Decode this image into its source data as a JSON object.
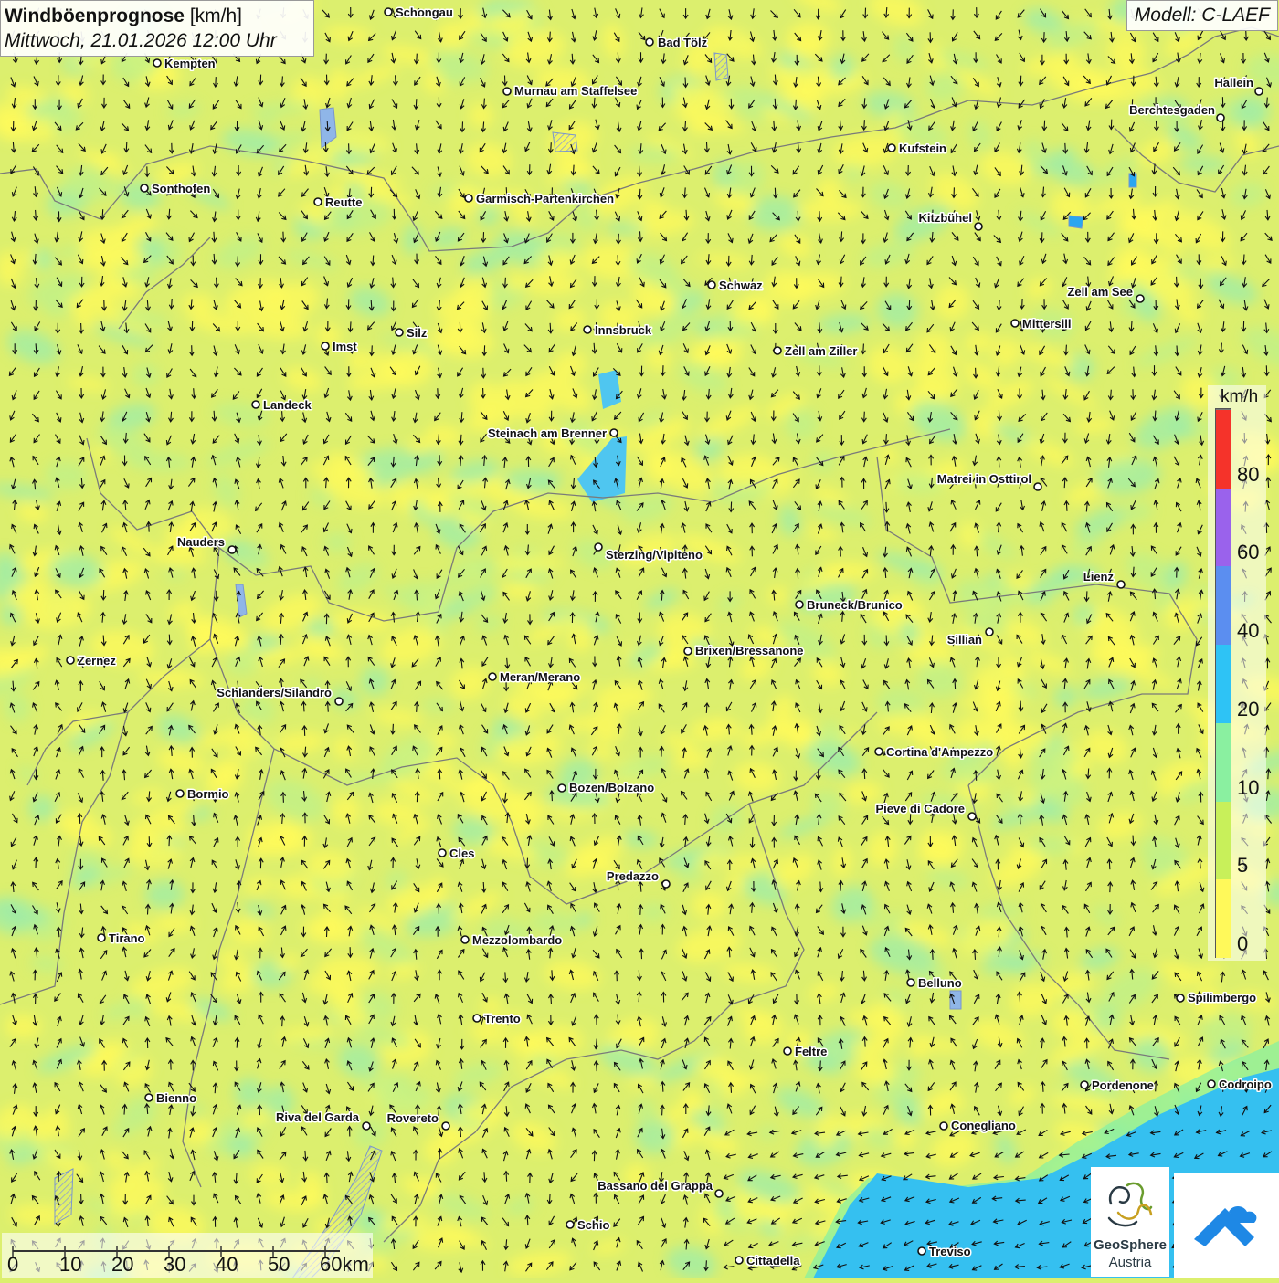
{
  "header": {
    "title_bold": "Windböenprognose",
    "title_unit": "[km/h]",
    "datetime": "Mittwoch, 21.01.2026 12:00 Uhr"
  },
  "model": {
    "label": "Modell: C-LAEF"
  },
  "legend": {
    "unit": "km/h",
    "steps": [
      {
        "label": "0",
        "color": "#fff95a"
      },
      {
        "label": "5",
        "color": "#c8f05a"
      },
      {
        "label": "10",
        "color": "#8af0a0"
      },
      {
        "label": "20",
        "color": "#2ec3f5"
      },
      {
        "label": "40",
        "color": "#5b8ef0"
      },
      {
        "label": "60",
        "color": "#9a62ec"
      },
      {
        "label": "80",
        "color": "#f5332a"
      }
    ]
  },
  "scalebar": {
    "labels": [
      "0",
      "10",
      "20",
      "30",
      "40",
      "50",
      "60km"
    ]
  },
  "logos": {
    "geosphere_name": "GeoSphere",
    "geosphere_sub": "Austria"
  },
  "cities": [
    "Schongau",
    "Bad Tölz",
    "Kempten",
    "Murnau am Staffelsee",
    "Hallein",
    "Berchtesgaden",
    "Kufstein",
    "Sonthofen",
    "Reutte",
    "Garmisch-Partenkirchen",
    "Kitzbühel",
    "Schwaz",
    "Zell am See",
    "Innsbruck",
    "Silz",
    "Mittersill",
    "Imst",
    "Zell am Ziller",
    "Landeck",
    "Steinach am Brenner",
    "Matrei in Osttirol",
    "Nauders",
    "Sterzing/Vipiteno",
    "Lienz",
    "Bruneck/Brunico",
    "Sillian",
    "Zernez",
    "Brixen/Bressanone",
    "Meran/Merano",
    "Schlanders/Silandro",
    "Cortina d'Ampezzo",
    "Bozen/Bolzano",
    "Bormio",
    "Pieve di Cadore",
    "Cles",
    "Predazzo",
    "Tirano",
    "Mezzolombardo",
    "Belluno",
    "Spilimbergo",
    "Trento",
    "Feltre",
    "Pordenone",
    "Codroipo",
    "Bienno",
    "Riva del Garda",
    "Rovereto",
    "Conegliano",
    "Bassano del Grappa",
    "Schio",
    "Treviso",
    "Cittadella"
  ]
}
